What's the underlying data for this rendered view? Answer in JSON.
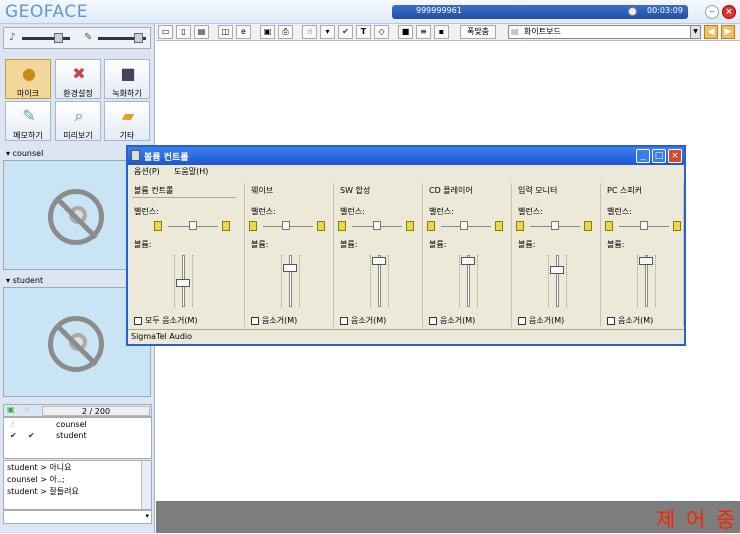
{
  "app": {
    "logo": "GEOFACE",
    "user_id": "999999961",
    "timer": "00:03:09",
    "min_label": "–",
    "close_label": "×"
  },
  "toolpanel": {
    "tools": [
      {
        "label": "마이크",
        "icon": "microphone-icon",
        "selected": true
      },
      {
        "label": "환경설정",
        "icon": "settings-icon",
        "selected": false
      },
      {
        "label": "녹화하기",
        "icon": "camera-icon",
        "selected": false
      },
      {
        "label": "메모하기",
        "icon": "memo-icon",
        "selected": false
      },
      {
        "label": "미리보기",
        "icon": "preview-icon",
        "selected": false
      },
      {
        "label": "기타",
        "icon": "folder-icon",
        "selected": false
      }
    ]
  },
  "panes": {
    "counsel": "counsel",
    "student": "student"
  },
  "userlist": {
    "count": "2 / 200",
    "users": [
      "counsel",
      "student"
    ]
  },
  "chat": {
    "lines": [
      "student > 아니요",
      "counsel > 아..;",
      "student > 잘들려요"
    ]
  },
  "toolbar": {
    "font_button": "폭맞춤",
    "board_select": "화이트보드"
  },
  "status": {
    "text": "제 어 중",
    "color": "#ff2200"
  },
  "volume_window": {
    "title": "볼륨 컨트롤",
    "menu": [
      "옵션(P)",
      "도움말(H)"
    ],
    "balance_label": "밸런스:",
    "volume_label": "볼륨:",
    "columns": [
      {
        "title": "볼륨 컨트롤",
        "mute": "모두 음소거(M)"
      },
      {
        "title": "웨이브",
        "mute": "음소거(M)"
      },
      {
        "title": "SW 합성",
        "mute": "음소거(M)"
      },
      {
        "title": "CD 플레이어",
        "mute": "음소거(M)"
      },
      {
        "title": "입력 모니터",
        "mute": "음소거(M)"
      },
      {
        "title": "PC 스피커",
        "mute": "음소거(M)"
      }
    ],
    "status": "SigmaTel Audio"
  }
}
